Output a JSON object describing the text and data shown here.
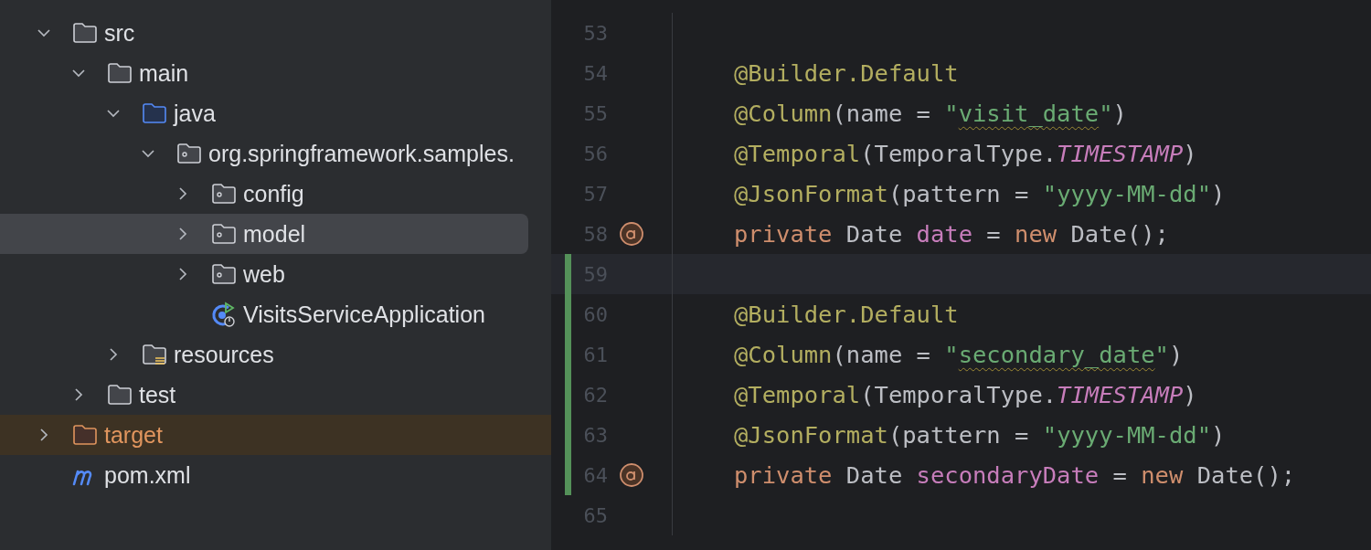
{
  "project_tree": {
    "items": [
      {
        "label": "src",
        "kind": "folder",
        "expanded": true,
        "selected": false,
        "children": [
          {
            "label": "main",
            "kind": "folder",
            "expanded": true,
            "selected": false,
            "children": [
              {
                "label": "java",
                "kind": "source-folder",
                "expanded": true,
                "selected": false,
                "children": [
                  {
                    "label": "org.springframework.samples.",
                    "kind": "package",
                    "expanded": true,
                    "selected": false,
                    "children": [
                      {
                        "label": "config",
                        "kind": "package",
                        "expanded": false,
                        "selected": false
                      },
                      {
                        "label": "model",
                        "kind": "package",
                        "expanded": false,
                        "selected": true
                      },
                      {
                        "label": "web",
                        "kind": "package",
                        "expanded": false,
                        "selected": false
                      },
                      {
                        "label": "VisitsServiceApplication",
                        "kind": "spring-app",
                        "selected": false
                      }
                    ]
                  }
                ]
              },
              {
                "label": "resources",
                "kind": "resource-folder",
                "expanded": false,
                "selected": false
              }
            ]
          },
          {
            "label": "test",
            "kind": "folder",
            "expanded": false,
            "selected": false
          }
        ]
      },
      {
        "label": "target",
        "kind": "excluded-folder",
        "expanded": false,
        "selected": false
      },
      {
        "label": "pom.xml",
        "kind": "maven-file",
        "selected": false
      }
    ]
  },
  "editor": {
    "lines": [
      {
        "number": "53",
        "marker": false,
        "changed": false,
        "current": false
      },
      {
        "number": "54",
        "marker": false,
        "changed": false,
        "current": false,
        "tokens": [
          {
            "kind": "annotation",
            "text": "@Builder.Default"
          }
        ]
      },
      {
        "number": "55",
        "marker": false,
        "changed": false,
        "current": false,
        "tokens": [
          {
            "kind": "annotation",
            "text": "@Column"
          },
          {
            "kind": "plain",
            "text": "(name = "
          },
          {
            "kind": "string",
            "text": "\""
          },
          {
            "kind": "string-typo",
            "text": "visit_date"
          },
          {
            "kind": "string",
            "text": "\""
          },
          {
            "kind": "plain",
            "text": ")"
          }
        ]
      },
      {
        "number": "56",
        "marker": false,
        "changed": false,
        "current": false,
        "tokens": [
          {
            "kind": "annotation",
            "text": "@Temporal"
          },
          {
            "kind": "plain",
            "text": "(TemporalType."
          },
          {
            "kind": "constant",
            "text": "TIMESTAMP"
          },
          {
            "kind": "plain",
            "text": ")"
          }
        ]
      },
      {
        "number": "57",
        "marker": false,
        "changed": false,
        "current": false,
        "tokens": [
          {
            "kind": "annotation",
            "text": "@JsonFormat"
          },
          {
            "kind": "plain",
            "text": "(pattern = "
          },
          {
            "kind": "string",
            "text": "\"yyyy-MM-dd\""
          },
          {
            "kind": "plain",
            "text": ")"
          }
        ]
      },
      {
        "number": "58",
        "marker": true,
        "changed": false,
        "current": false,
        "tokens": [
          {
            "kind": "keyword",
            "text": "private "
          },
          {
            "kind": "plain",
            "text": "Date "
          },
          {
            "kind": "field",
            "text": "date"
          },
          {
            "kind": "plain",
            "text": " = "
          },
          {
            "kind": "keyword",
            "text": "new "
          },
          {
            "kind": "plain",
            "text": "Date();"
          }
        ]
      },
      {
        "number": "59",
        "marker": false,
        "changed": true,
        "current": true
      },
      {
        "number": "60",
        "marker": false,
        "changed": true,
        "current": false,
        "tokens": [
          {
            "kind": "annotation",
            "text": "@Builder.Default"
          }
        ]
      },
      {
        "number": "61",
        "marker": false,
        "changed": true,
        "current": false,
        "tokens": [
          {
            "kind": "annotation",
            "text": "@Column"
          },
          {
            "kind": "plain",
            "text": "(name = "
          },
          {
            "kind": "string",
            "text": "\""
          },
          {
            "kind": "string-typo",
            "text": "secondary_date"
          },
          {
            "kind": "string",
            "text": "\""
          },
          {
            "kind": "plain",
            "text": ")"
          }
        ]
      },
      {
        "number": "62",
        "marker": false,
        "changed": true,
        "current": false,
        "tokens": [
          {
            "kind": "annotation",
            "text": "@Temporal"
          },
          {
            "kind": "plain",
            "text": "(TemporalType."
          },
          {
            "kind": "constant",
            "text": "TIMESTAMP"
          },
          {
            "kind": "plain",
            "text": ")"
          }
        ]
      },
      {
        "number": "63",
        "marker": false,
        "changed": true,
        "current": false,
        "tokens": [
          {
            "kind": "annotation",
            "text": "@JsonFormat"
          },
          {
            "kind": "plain",
            "text": "(pattern = "
          },
          {
            "kind": "string",
            "text": "\"yyyy-MM-dd\""
          },
          {
            "kind": "plain",
            "text": ")"
          }
        ]
      },
      {
        "number": "64",
        "marker": true,
        "changed": true,
        "current": false,
        "tokens": [
          {
            "kind": "keyword",
            "text": "private "
          },
          {
            "kind": "plain",
            "text": "Date "
          },
          {
            "kind": "field",
            "text": "secondaryDate"
          },
          {
            "kind": "plain",
            "text": " = "
          },
          {
            "kind": "keyword",
            "text": "new "
          },
          {
            "kind": "plain",
            "text": "Date();"
          }
        ]
      },
      {
        "number": "65",
        "marker": false,
        "changed": false,
        "current": false
      }
    ]
  }
}
